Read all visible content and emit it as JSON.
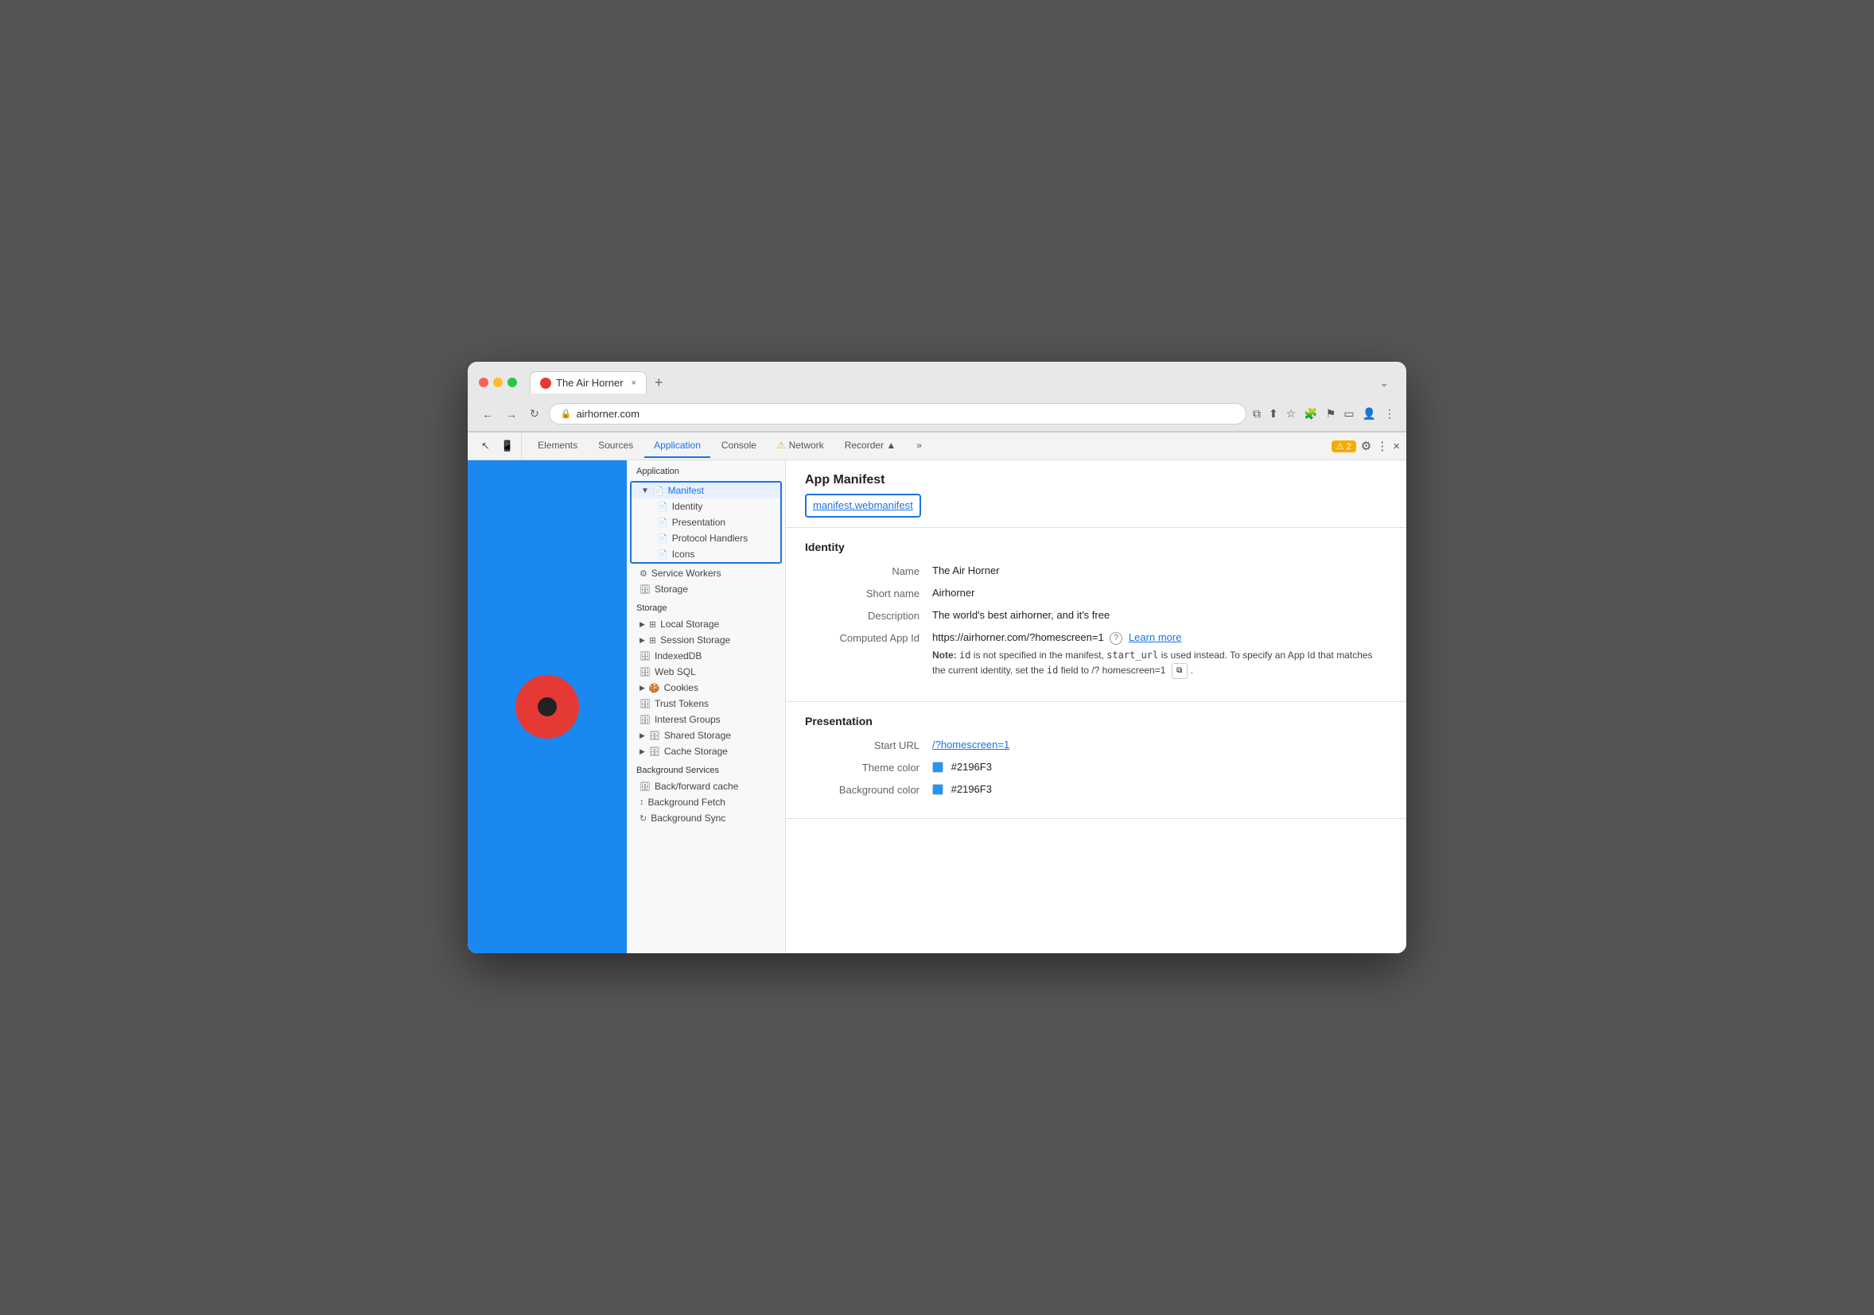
{
  "browser": {
    "tab_title": "The Air Horner",
    "tab_close": "×",
    "tab_new": "+",
    "url": "airhorner.com",
    "chevron_down": "⌄",
    "nav": {
      "back": "←",
      "forward": "→",
      "refresh": "↻"
    }
  },
  "devtools": {
    "tab_icons": [
      "⬜",
      "⬜"
    ],
    "tabs": [
      {
        "label": "Elements",
        "active": false
      },
      {
        "label": "Sources",
        "active": false
      },
      {
        "label": "Application",
        "active": true
      },
      {
        "label": "Console",
        "active": false
      },
      {
        "label": "⚠ Network",
        "active": false
      },
      {
        "label": "Recorder ▲",
        "active": false
      },
      {
        "label": "»",
        "active": false
      }
    ],
    "warning_count": "⚠ 2",
    "gear_icon": "⚙",
    "more_icon": "⋮",
    "close_icon": "×"
  },
  "sidebar": {
    "application_header": "Application",
    "items": [
      {
        "id": "manifest",
        "label": "Manifest",
        "icon": "📄",
        "arrow": "▼",
        "selected": true,
        "grouped": true
      },
      {
        "id": "identity",
        "label": "Identity",
        "icon": "📄",
        "indent": true,
        "grouped": true
      },
      {
        "id": "presentation",
        "label": "Presentation",
        "icon": "📄",
        "indent": true,
        "grouped": true
      },
      {
        "id": "protocol-handlers",
        "label": "Protocol Handlers",
        "icon": "📄",
        "indent": true,
        "grouped": true
      },
      {
        "id": "icons",
        "label": "Icons",
        "icon": "📄",
        "indent": true,
        "grouped": true
      },
      {
        "id": "service-workers",
        "label": "Service Workers",
        "icon": "⚙",
        "indent": false
      },
      {
        "id": "storage",
        "label": "Storage",
        "icon": "🗄",
        "indent": false
      }
    ],
    "storage_header": "Storage",
    "storage_items": [
      {
        "id": "local-storage",
        "label": "Local Storage",
        "icon": "⊞",
        "arrow": "▶"
      },
      {
        "id": "session-storage",
        "label": "Session Storage",
        "icon": "⊞",
        "arrow": "▶"
      },
      {
        "id": "indexed-db",
        "label": "IndexedDB",
        "icon": "🗄"
      },
      {
        "id": "web-sql",
        "label": "Web SQL",
        "icon": "🗄"
      },
      {
        "id": "cookies",
        "label": "Cookies",
        "icon": "🍪",
        "arrow": "▶"
      },
      {
        "id": "trust-tokens",
        "label": "Trust Tokens",
        "icon": "🗄"
      },
      {
        "id": "interest-groups",
        "label": "Interest Groups",
        "icon": "🗄"
      },
      {
        "id": "shared-storage",
        "label": "Shared Storage",
        "icon": "🗄",
        "arrow": "▶"
      },
      {
        "id": "cache-storage",
        "label": "Cache Storage",
        "icon": "🗄",
        "arrow": "▶"
      }
    ],
    "bg_services_header": "Background Services",
    "bg_items": [
      {
        "id": "back-forward-cache",
        "label": "Back/forward cache",
        "icon": "🗄"
      },
      {
        "id": "background-fetch",
        "label": "Background Fetch",
        "icon": "↕"
      },
      {
        "id": "background-sync",
        "label": "Background Sync",
        "icon": "↻"
      }
    ]
  },
  "main": {
    "title": "App Manifest",
    "manifest_link": "manifest.webmanifest",
    "identity_section": {
      "title": "Identity",
      "fields": [
        {
          "label": "Name",
          "value": "The Air Horner"
        },
        {
          "label": "Short name",
          "value": "Airhorner"
        },
        {
          "label": "Description",
          "value": "The world's best airhorner, and it's free"
        },
        {
          "label": "Computed App Id",
          "value": "https://airhorner.com/?homescreen=1"
        }
      ],
      "learn_more": "Learn more",
      "note": "Note: id is not specified in the manifest, start_url is used instead. To specify an App Id that matches the current identity, set the id field to /?homescreen=1",
      "copy_value": "/?homescreen=1"
    },
    "presentation_section": {
      "title": "Presentation",
      "fields": [
        {
          "label": "Start URL",
          "value": "/?homescreen=1",
          "link": true
        },
        {
          "label": "Theme color",
          "value": "#2196F3",
          "color": "#2196F3"
        },
        {
          "label": "Background color",
          "value": "#2196F3",
          "color": "#2196F3"
        }
      ]
    }
  }
}
